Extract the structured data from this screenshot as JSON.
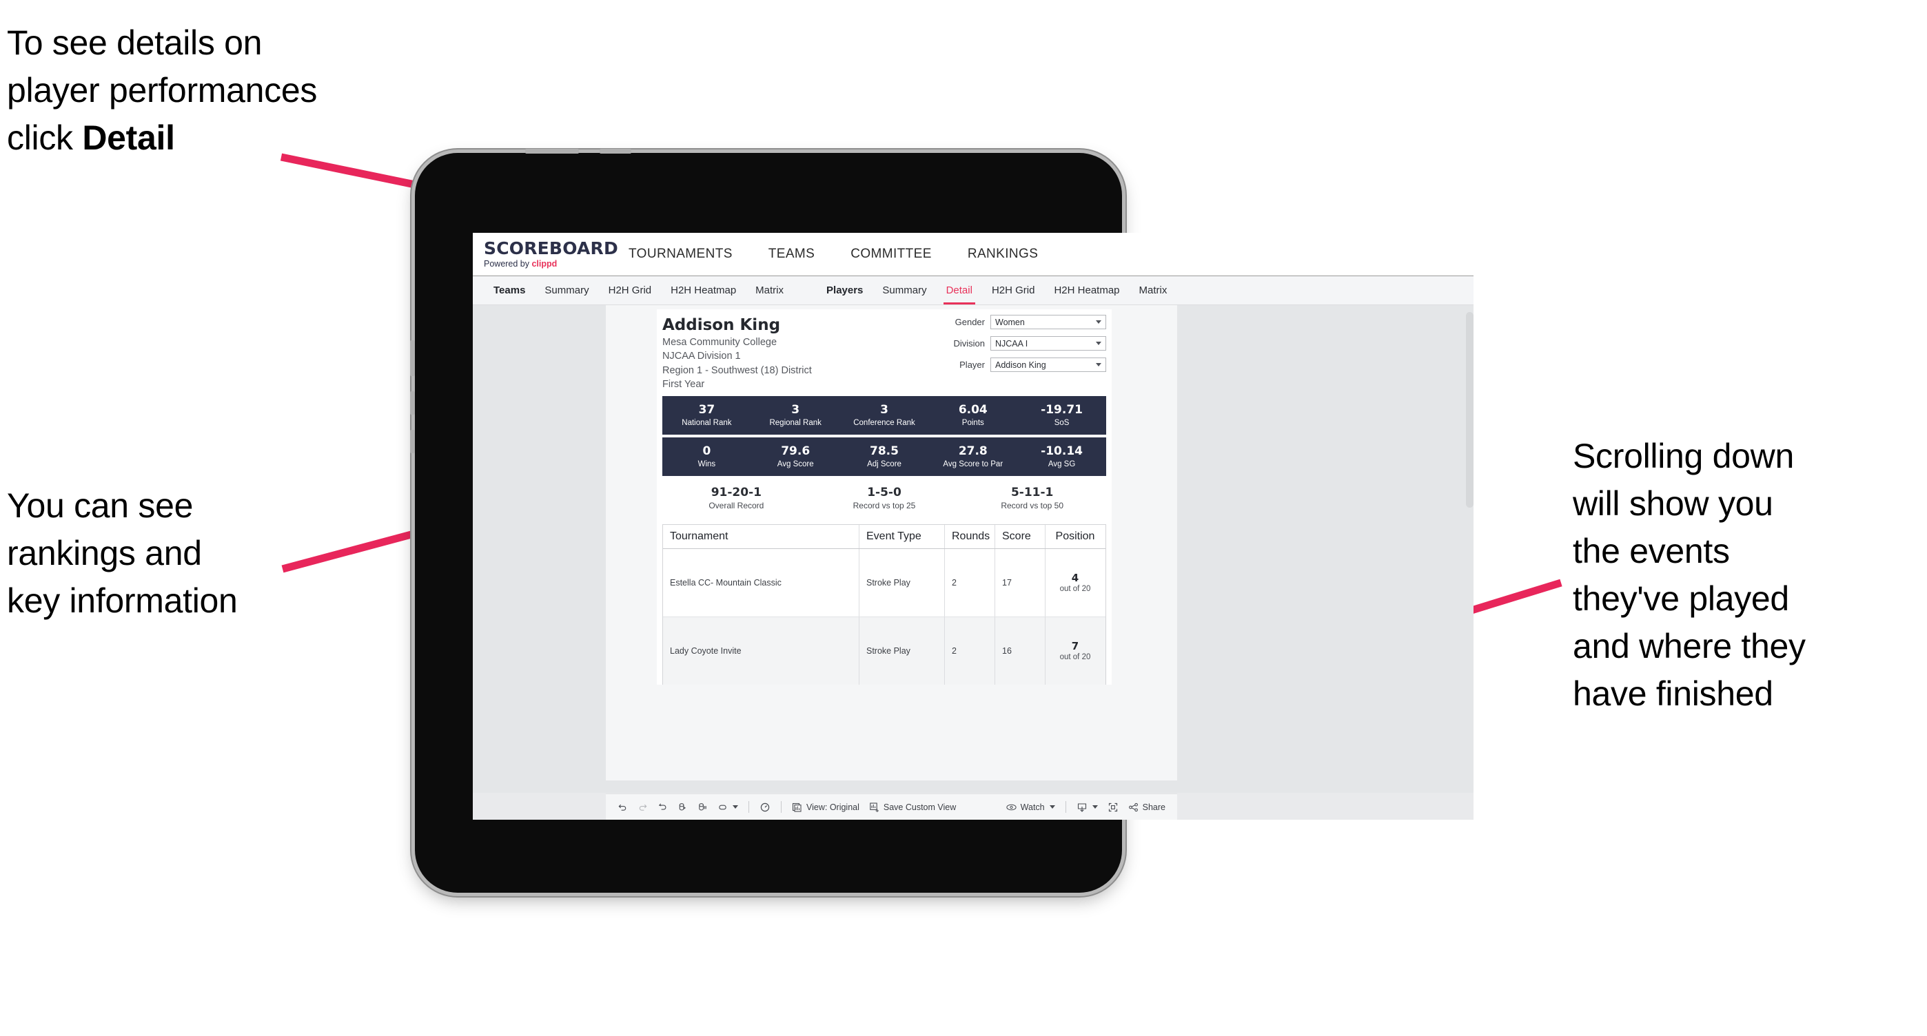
{
  "annotations": {
    "top_left": "To see details on\nplayer performances\nclick ",
    "top_left_bold": "Detail",
    "mid_left": "You can see\nrankings and\nkey information",
    "right": "Scrolling down\nwill show you\nthe events\nthey've played\nand where they\nhave finished",
    "arrow_color": "#e8265b"
  },
  "app": {
    "brand": {
      "title": "SCOREBOARD",
      "powered_prefix": "Powered by ",
      "powered_name": "clippd"
    },
    "topnav": [
      {
        "label": "TOURNAMENTS"
      },
      {
        "label": "TEAMS"
      },
      {
        "label": "COMMITTEE"
      },
      {
        "label": "RANKINGS"
      }
    ],
    "subnav": {
      "teams_group_label": "Teams",
      "teams_tabs": [
        {
          "label": "Summary",
          "active": false
        },
        {
          "label": "H2H Grid",
          "active": false
        },
        {
          "label": "H2H Heatmap",
          "active": false
        },
        {
          "label": "Matrix",
          "active": false
        }
      ],
      "players_group_label": "Players",
      "players_tabs": [
        {
          "label": "Summary",
          "active": false
        },
        {
          "label": "Detail",
          "active": true
        },
        {
          "label": "H2H Grid",
          "active": false
        },
        {
          "label": "H2H Heatmap",
          "active": false
        },
        {
          "label": "Matrix",
          "active": false
        }
      ]
    },
    "player": {
      "name": "Addison King",
      "school": "Mesa Community College",
      "division": "NJCAA Division 1",
      "region": "Region 1 - Southwest (18) District",
      "year": "First Year"
    },
    "filters": [
      {
        "label": "Gender",
        "value": "Women"
      },
      {
        "label": "Division",
        "value": "NJCAA I"
      },
      {
        "label": "Player",
        "value": "Addison King"
      }
    ],
    "kpi_row_1": [
      {
        "value": "37",
        "label": "National Rank"
      },
      {
        "value": "3",
        "label": "Regional Rank"
      },
      {
        "value": "3",
        "label": "Conference Rank"
      },
      {
        "value": "6.04",
        "label": "Points"
      },
      {
        "value": "-19.71",
        "label": "SoS"
      }
    ],
    "kpi_row_2": [
      {
        "value": "0",
        "label": "Wins"
      },
      {
        "value": "79.6",
        "label": "Avg Score"
      },
      {
        "value": "78.5",
        "label": "Adj Score"
      },
      {
        "value": "27.8",
        "label": "Avg Score to Par"
      },
      {
        "value": "-10.14",
        "label": "Avg SG"
      }
    ],
    "records": [
      {
        "value": "91-20-1",
        "label": "Overall Record"
      },
      {
        "value": "1-5-0",
        "label": "Record vs top 25"
      },
      {
        "value": "5-11-1",
        "label": "Record vs top 50"
      }
    ],
    "table": {
      "columns": [
        "Tournament",
        "Event Type",
        "Rounds",
        "Score",
        "Position"
      ],
      "rows": [
        {
          "tournament": "Estella CC- Mountain Classic",
          "event_type": "Stroke Play",
          "rounds": "2",
          "score": "17",
          "position_num": "4",
          "position_sub": "out of 20"
        },
        {
          "tournament": "Lady Coyote Invite",
          "event_type": "Stroke Play",
          "rounds": "2",
          "score": "16",
          "position_num": "7",
          "position_sub": "out of 20"
        }
      ]
    },
    "toolbar": {
      "view_label": "View: Original",
      "save_label": "Save Custom View",
      "watch_label": "Watch",
      "share_label": "Share"
    },
    "colors": {
      "accent": "#e8325a",
      "kpi_bar": "#2b3148",
      "brand_dark": "#2c3049"
    }
  }
}
